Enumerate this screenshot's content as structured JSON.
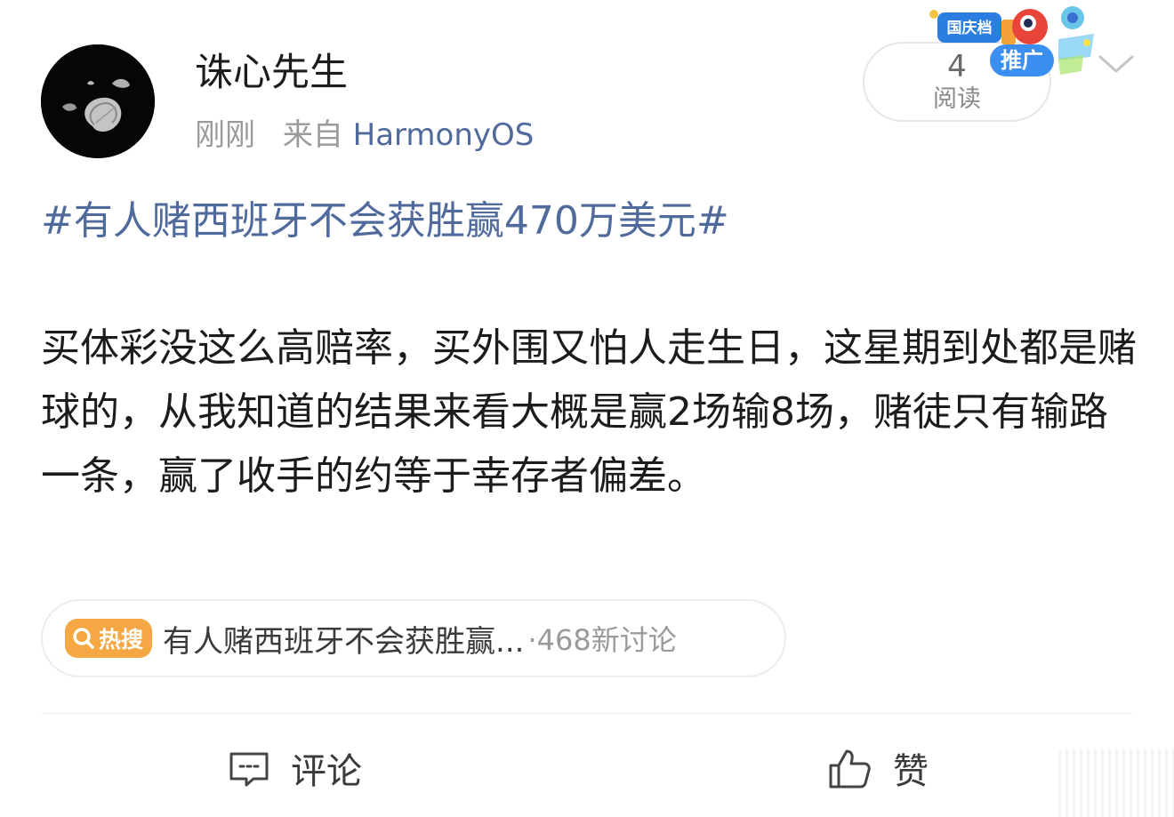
{
  "post": {
    "author": "诛心先生",
    "time": "刚刚",
    "source_prefix": "来自",
    "source": "HarmonyOS",
    "reads": {
      "count": "4",
      "label": "阅读"
    },
    "promo": {
      "badge": "推广",
      "banner_text": "国庆档"
    },
    "topic": "#有人赌西班牙不会获胜赢470万美元#",
    "body": "买体彩没这么高赔率，买外围又怕人走生日，这星期到处都是赌球的，从我知道的结果来看大概是赢2场输8场，赌徒只有输路一条，赢了收手的约等于幸存者偏差。"
  },
  "hot_search": {
    "badge": "热搜",
    "title": "有人赌西班牙不会获胜赢...",
    "count": "·468新讨论"
  },
  "actions": {
    "comment_label": "评论",
    "like_label": "赞"
  },
  "icons": {
    "more": "chevron-down-icon",
    "comment": "comment-icon",
    "like": "thumbs-up-icon",
    "search": "search-icon"
  },
  "colors": {
    "link": "#506a9c",
    "hot_badge": "#f4a742",
    "promo_badge": "#3b8ff0"
  }
}
